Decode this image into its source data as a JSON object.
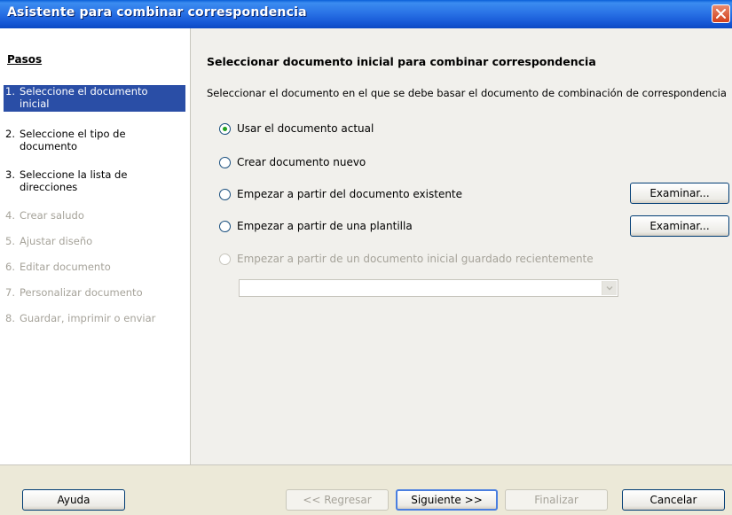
{
  "window": {
    "title": "Asistente para combinar correspondencia"
  },
  "sidebar": {
    "title": "Pasos",
    "steps": [
      {
        "num": "1.",
        "label": "Seleccione el documento inicial",
        "state": "active"
      },
      {
        "num": "2.",
        "label": "Seleccione el tipo de documento",
        "state": "enabled"
      },
      {
        "num": "3.",
        "label": "Seleccione la lista de direcciones",
        "state": "enabled"
      },
      {
        "num": "4.",
        "label": "Crear saludo",
        "state": "disabled"
      },
      {
        "num": "5.",
        "label": "Ajustar diseño",
        "state": "disabled"
      },
      {
        "num": "6.",
        "label": "Editar documento",
        "state": "disabled"
      },
      {
        "num": "7.",
        "label": "Personalizar documento",
        "state": "disabled"
      },
      {
        "num": "8.",
        "label": "Guardar, imprimir o enviar",
        "state": "disabled"
      }
    ]
  },
  "main": {
    "heading": "Seleccionar documento inicial para combinar correspondencia",
    "description": "Seleccionar el documento en el que se debe basar el documento de combinación de correspondencia",
    "options": [
      {
        "label": "Usar el documento actual",
        "checked": true,
        "enabled": true
      },
      {
        "label": "Crear documento nuevo",
        "checked": false,
        "enabled": true
      },
      {
        "label": "Empezar a partir del documento existente",
        "checked": false,
        "enabled": true
      },
      {
        "label": "Empezar a partir de una plantilla",
        "checked": false,
        "enabled": true
      },
      {
        "label": "Empezar a partir de un documento inicial guardado recientemente",
        "checked": false,
        "enabled": false
      }
    ],
    "browse_existing_label": "Examinar...",
    "browse_template_label": "Examinar...",
    "recent_combo_value": ""
  },
  "footer": {
    "help_label": "Ayuda",
    "back_label": "<< Regresar",
    "next_label": "Siguiente >>",
    "finish_label": "Finalizar",
    "cancel_label": "Cancelar"
  },
  "colors": {
    "title_bar": "#2A73E6",
    "active_step": "#2A4EA6",
    "radio_checked": "#21A121"
  },
  "icons": {
    "close": "close-icon",
    "combo_arrow": "chevron-down-icon"
  }
}
